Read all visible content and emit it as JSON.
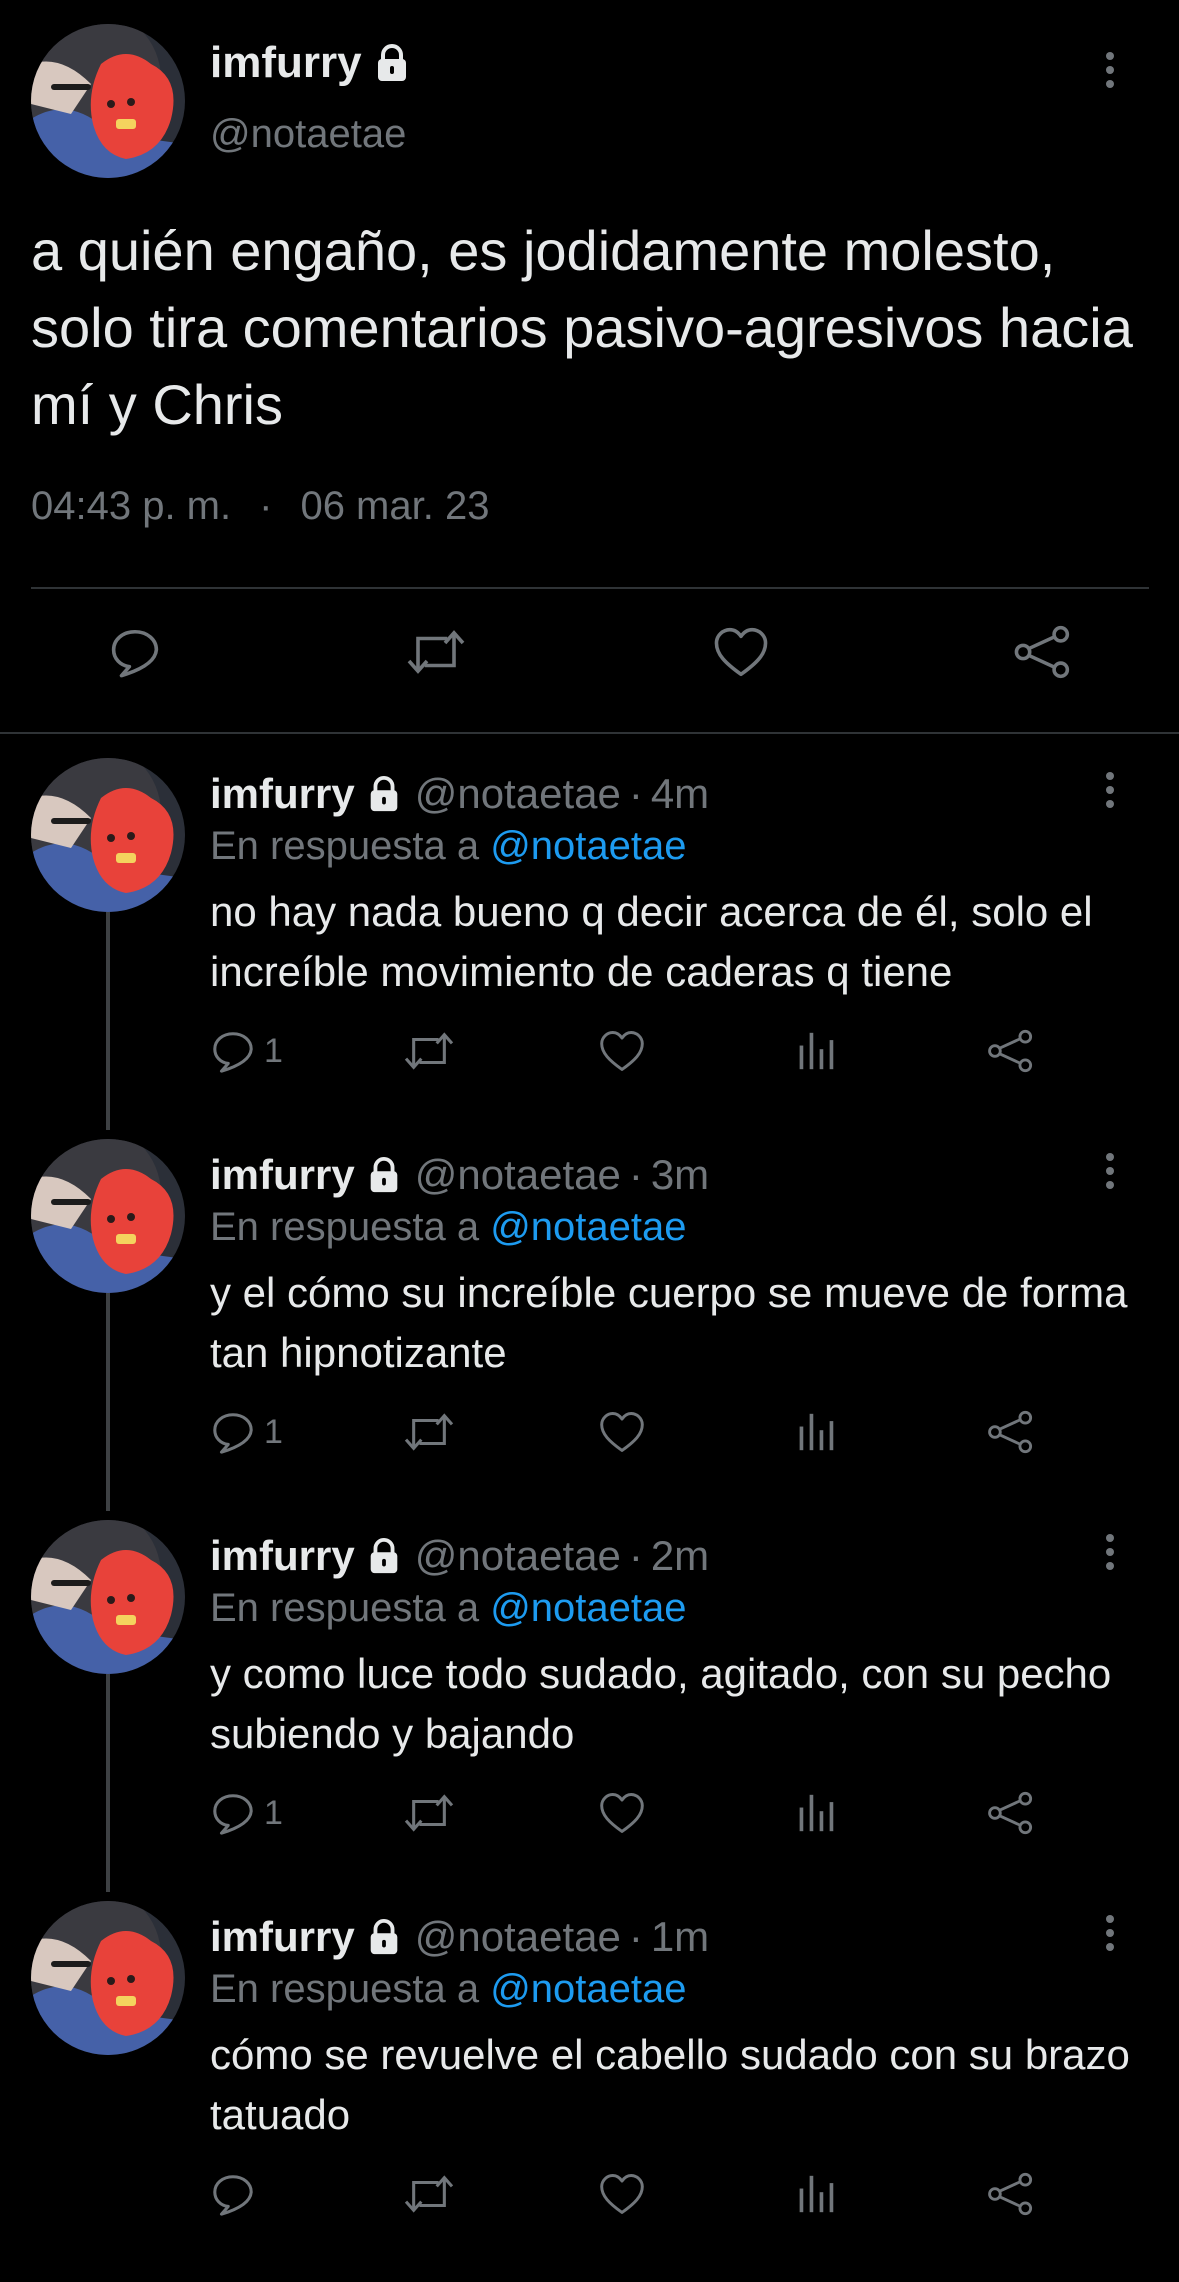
{
  "colors": {
    "background": "#000000",
    "text": "#e7e9ea",
    "muted": "#71767b",
    "accent": "#1d9bf0",
    "divider": "#2f3336"
  },
  "tweet": {
    "display_name": "imfurry",
    "handle": "@notaetae",
    "lock_icon": "lock-icon",
    "text": "a quién engaño, es jodidamente molesto, solo tira comentarios pasivo-agresivos hacia mí y Chris",
    "time": "04:43 p. m.",
    "dot": "·",
    "date": "06 mar. 23",
    "actions": [
      "reply-icon",
      "retweet-icon",
      "like-icon",
      "share-icon"
    ]
  },
  "replies": [
    {
      "display_name": "imfurry",
      "handle": "@notaetae",
      "sep": "·",
      "time": "4m",
      "reply_prefix": "En respuesta a",
      "reply_to": "@notaetae",
      "text": "no hay nada bueno q decir acerca de él, solo el increíble movimiento de caderas q tiene",
      "reply_count": "1"
    },
    {
      "display_name": "imfurry",
      "handle": "@notaetae",
      "sep": "·",
      "time": "3m",
      "reply_prefix": "En respuesta a",
      "reply_to": "@notaetae",
      "text": "y el cómo su increíble cuerpo se mueve de forma tan hipnotizante",
      "reply_count": "1"
    },
    {
      "display_name": "imfurry",
      "handle": "@notaetae",
      "sep": "·",
      "time": "2m",
      "reply_prefix": "En respuesta a",
      "reply_to": "@notaetae",
      "text": "y como luce todo sudado, agitado, con su pecho subiendo y bajando",
      "reply_count": "1"
    },
    {
      "display_name": "imfurry",
      "handle": "@notaetae",
      "sep": "·",
      "time": "1m",
      "reply_prefix": "En respuesta a",
      "reply_to": "@notaetae",
      "text": "cómo se revuelve el cabello sudado con su brazo tatuado",
      "reply_count": ""
    }
  ]
}
